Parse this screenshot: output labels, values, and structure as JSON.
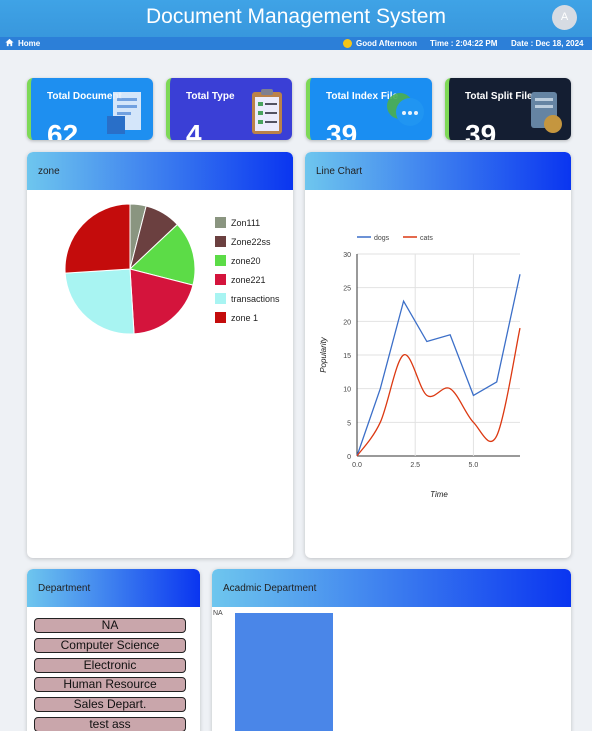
{
  "header": {
    "title": "Document Management System",
    "avatar_initial": "A"
  },
  "subbar": {
    "home": "Home",
    "greeting": "Good Afternoon",
    "time": "Time : 2:04:22 PM",
    "date": "Date : Dec 18, 2024"
  },
  "stats": [
    {
      "label": "Total Document",
      "value": "62",
      "bg": "#1e8ff0"
    },
    {
      "label": "Total Type",
      "value": "4",
      "bg": "#3a3fd6"
    },
    {
      "label": "Total Index File",
      "value": "39",
      "bg": "#1a8ef2"
    },
    {
      "label": "Total Split File",
      "value": "39",
      "bg": "#141e32"
    }
  ],
  "zone_panel": {
    "title": "zone",
    "legend": [
      {
        "label": "Zon111",
        "color": "#8a9580"
      },
      {
        "label": "Zone22ss",
        "color": "#6b4040"
      },
      {
        "label": "zone20",
        "color": "#5cdc47"
      },
      {
        "label": "zone221",
        "color": "#d4143c"
      },
      {
        "label": "transactions",
        "color": "#a8f4f2"
      },
      {
        "label": "zone 1",
        "color": "#c40c0c"
      }
    ]
  },
  "line_panel": {
    "title": "Line Chart"
  },
  "dept_panel": {
    "title": "Department",
    "items": [
      "NA",
      "Computer Science",
      "Electronic",
      "Human Resource",
      "Sales Depart.",
      "test ass"
    ]
  },
  "academic_panel": {
    "title": "Acadmic Department"
  },
  "chart_data": [
    {
      "type": "pie",
      "labels": [
        "Zon111",
        "Zone22ss",
        "zone20",
        "zone221",
        "transactions",
        "zone 1"
      ],
      "values": [
        4,
        9,
        16,
        20,
        25,
        26
      ],
      "colors": [
        "#8a9580",
        "#6b4040",
        "#5cdc47",
        "#d4143c",
        "#a8f4f2",
        "#c40c0c"
      ]
    },
    {
      "type": "line",
      "xlabel": "Time",
      "ylabel": "Popularity",
      "x": [
        0,
        1,
        2,
        3,
        4,
        5,
        6,
        7
      ],
      "xlim": [
        0,
        7
      ],
      "ylim": [
        0,
        30
      ],
      "xticks": [
        "0.0",
        "2.5",
        "5.0"
      ],
      "xtick_values": [
        0,
        2.5,
        5
      ],
      "yticks": [
        0,
        5,
        10,
        15,
        20,
        25,
        30
      ],
      "legend_position": "top-left",
      "series": [
        {
          "name": "dogs",
          "color": "#3c6fc8",
          "values": [
            0,
            10,
            23,
            17,
            18,
            9,
            11,
            27
          ]
        },
        {
          "name": "cats",
          "color": "#dc3912",
          "values": [
            0,
            5,
            15,
            9,
            10,
            5,
            3,
            19
          ]
        }
      ]
    },
    {
      "type": "bar",
      "categories": [
        "NA"
      ],
      "values": [
        1
      ],
      "color": "#4a86e8"
    }
  ]
}
